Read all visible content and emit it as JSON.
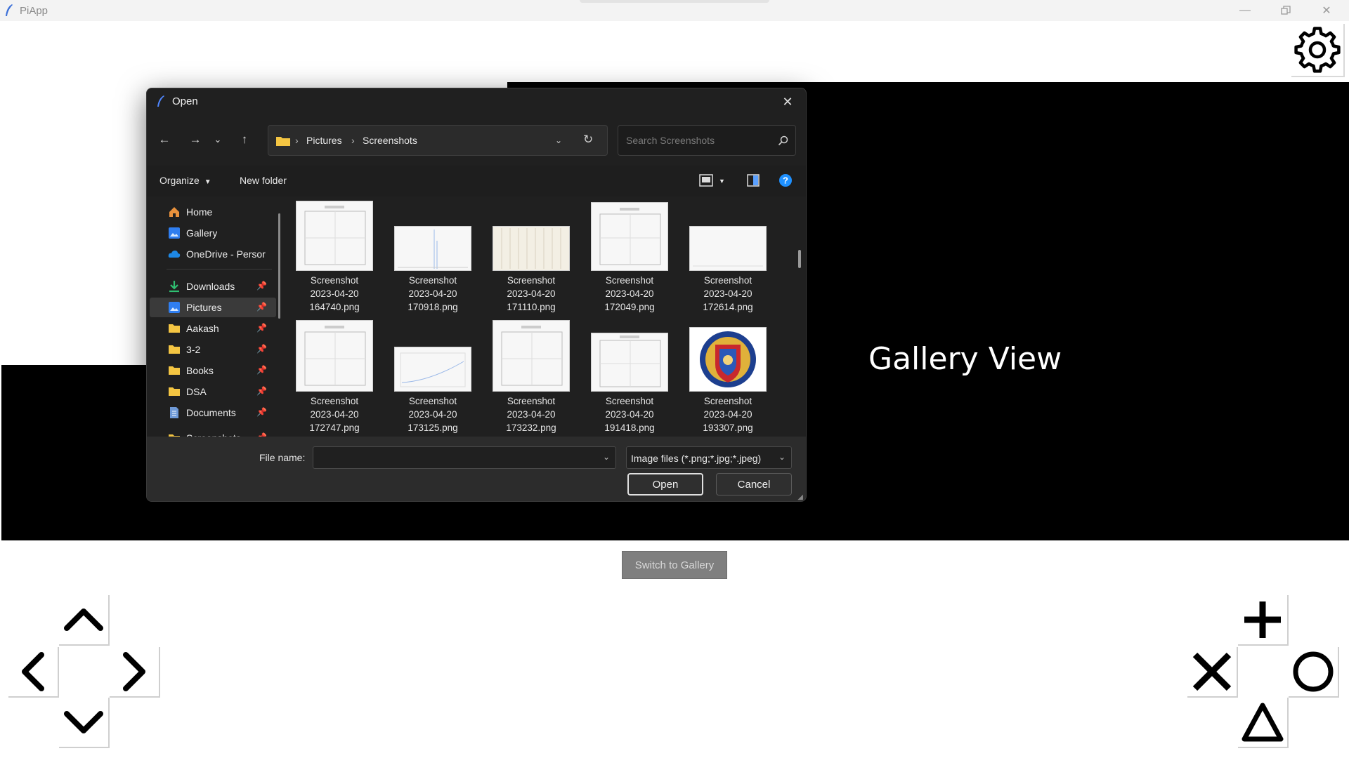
{
  "app": {
    "title": "PiApp"
  },
  "gallery_label": "Gallery View",
  "switch_button": "Switch to Gallery",
  "dialog": {
    "title": "Open",
    "breadcrumb": [
      "Pictures",
      "Screenshots"
    ],
    "search_placeholder": "Search Screenshots",
    "toolbar": {
      "organize": "Organize",
      "new_folder": "New folder"
    },
    "nav_items": [
      {
        "label": "Home",
        "icon": "home-icon",
        "pinned": false
      },
      {
        "label": "Gallery",
        "icon": "gallery-icon",
        "pinned": false
      },
      {
        "label": "OneDrive - Persor",
        "icon": "onedrive-icon",
        "pinned": false
      },
      {
        "label": "Downloads",
        "icon": "download-icon",
        "pinned": true
      },
      {
        "label": "Pictures",
        "icon": "pictures-icon",
        "pinned": true,
        "selected": true
      },
      {
        "label": "Aakash",
        "icon": "folder-icon",
        "pinned": true
      },
      {
        "label": "3-2",
        "icon": "folder-icon",
        "pinned": true
      },
      {
        "label": "Books",
        "icon": "folder-icon",
        "pinned": true
      },
      {
        "label": "DSA",
        "icon": "folder-icon",
        "pinned": true
      },
      {
        "label": "Documents",
        "icon": "documents-icon",
        "pinned": true
      },
      {
        "label": "Screenshots",
        "icon": "folder-icon",
        "pinned": true
      }
    ],
    "files": [
      {
        "line1": "Screenshot",
        "line2": "2023-04-20",
        "line3": "164740.png"
      },
      {
        "line1": "Screenshot",
        "line2": "2023-04-20",
        "line3": "170918.png"
      },
      {
        "line1": "Screenshot",
        "line2": "2023-04-20",
        "line3": "171110.png"
      },
      {
        "line1": "Screenshot",
        "line2": "2023-04-20",
        "line3": "172049.png"
      },
      {
        "line1": "Screenshot",
        "line2": "2023-04-20",
        "line3": "172614.png"
      },
      {
        "line1": "Screenshot",
        "line2": "2023-04-20",
        "line3": "172747.png"
      },
      {
        "line1": "Screenshot",
        "line2": "2023-04-20",
        "line3": "173125.png"
      },
      {
        "line1": "Screenshot",
        "line2": "2023-04-20",
        "line3": "173232.png"
      },
      {
        "line1": "Screenshot",
        "line2": "2023-04-20",
        "line3": "191418.png"
      },
      {
        "line1": "Screenshot",
        "line2": "2023-04-20",
        "line3": "193307.png"
      }
    ],
    "file_name_label": "File name:",
    "file_name_value": "",
    "file_type": "Image files (*.png;*.jpg;*.jpeg)",
    "open_button": "Open",
    "cancel_button": "Cancel"
  },
  "colors": {
    "accent": "#1e90ff",
    "canvas": "#000000",
    "dialog_bg": "#202020",
    "folder": "#f4c542"
  }
}
